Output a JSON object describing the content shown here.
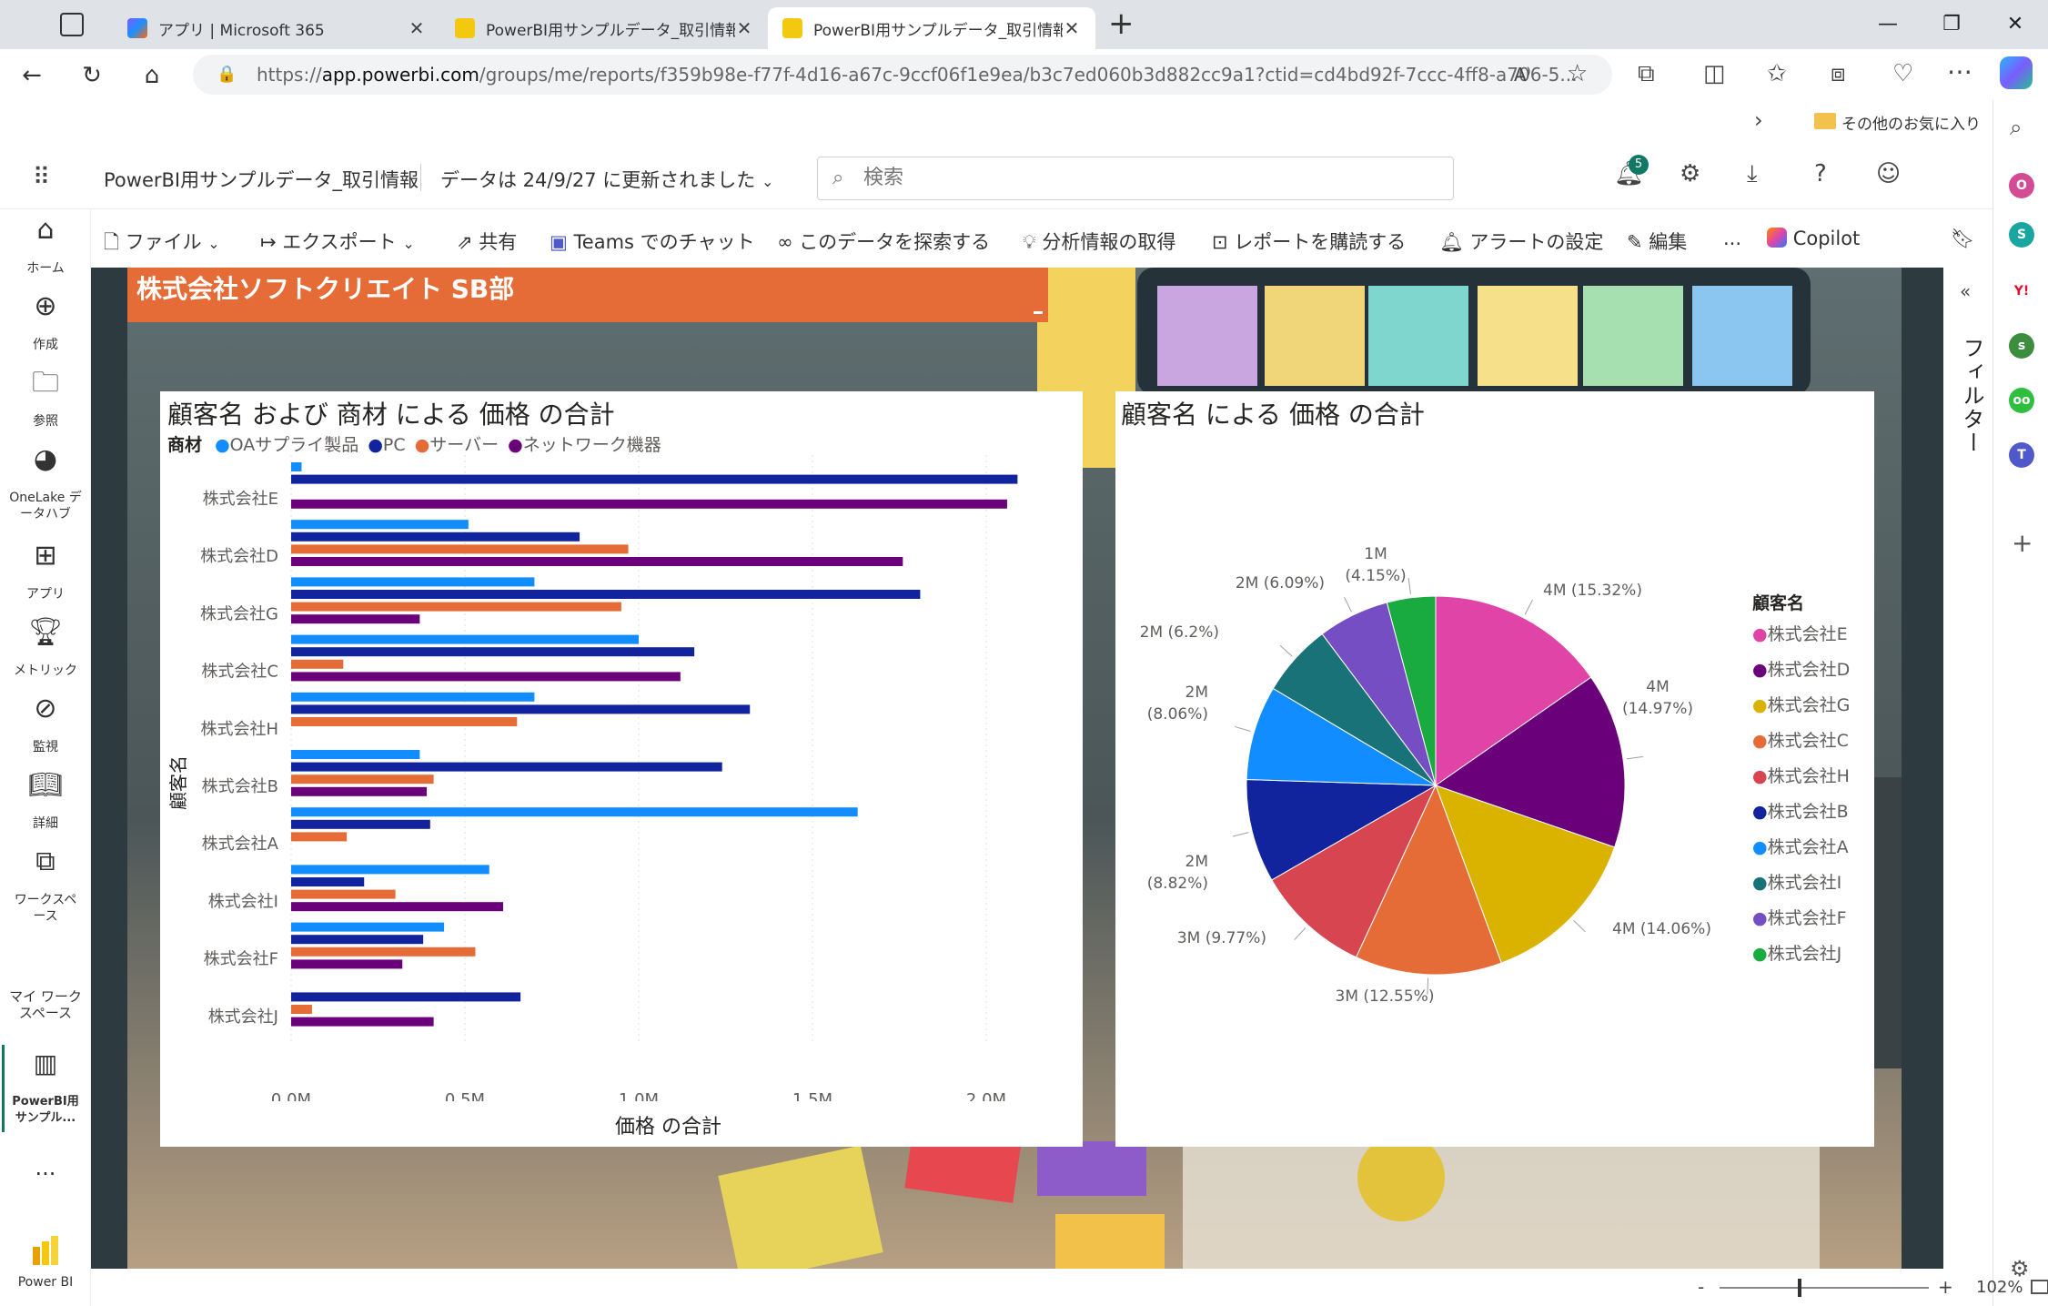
{
  "browser": {
    "tabs": [
      {
        "title": "アプリ | Microsoft 365",
        "active": false
      },
      {
        "title": "PowerBI用サンプルデータ_取引情報",
        "active": false
      },
      {
        "title": "PowerBI用サンプルデータ_取引情報",
        "active": true
      }
    ],
    "new_tab": "+",
    "url_prefix": "https://",
    "url_host": "app.powerbi.com",
    "url_rest": "/groups/me/reports/f359b98e-f77f-4d16-a67c-9ccf06f1e9ea/b3c7ed060b3d882cc9a1?ctid=cd4bd92f-7ccc-4ff8-a706-5...",
    "favorites_folder": "その他のお気に入り"
  },
  "pbi_header": {
    "report_title": "PowerBI用サンプルデータ_取引情報",
    "updated": "データは 24/9/27 に更新されました",
    "search_placeholder": "検索",
    "notification_count": "5"
  },
  "left_nav": [
    {
      "label": "ホーム",
      "icon": "home-icon"
    },
    {
      "label": "作成",
      "icon": "create-icon"
    },
    {
      "label": "参照",
      "icon": "browse-icon"
    },
    {
      "label": "OneLake デ\nータハブ",
      "icon": "onelake-icon"
    },
    {
      "label": "アプリ",
      "icon": "apps-icon"
    },
    {
      "label": "メトリック",
      "icon": "metrics-icon"
    },
    {
      "label": "監視",
      "icon": "monitor-icon"
    },
    {
      "label": "詳細",
      "icon": "learn-icon"
    },
    {
      "label": "ワークスペ\nース",
      "icon": "workspaces-icon"
    },
    {
      "label": "マイ ワーク\nスペース",
      "icon": ""
    },
    {
      "label": "PowerBI用\nサンプル...",
      "icon": "report-icon"
    },
    {
      "label": "...",
      "icon": ""
    },
    {
      "label": "Power BI",
      "icon": "powerbi-logo-icon"
    }
  ],
  "toolbar": {
    "file": "ファイル",
    "export": "エクスポート",
    "share": "共有",
    "teams": "Teams でのチャット",
    "explore": "このデータを探索する",
    "insights": "分析情報の取得",
    "subscribe": "レポートを購読する",
    "alert": "アラートの設定",
    "edit": "編集",
    "more": "...",
    "copilot": "Copilot"
  },
  "filter_pane_label": "フィルター",
  "report": {
    "banner_title": "株式会社ソフトクリエイト SB部"
  },
  "status": {
    "zoom": "102%",
    "minus": "-",
    "plus": "+"
  },
  "colors": {
    "banner": "#e66c37",
    "OA": "#118dff",
    "PC": "#12239e",
    "server": "#e66c37",
    "network": "#6b007b"
  },
  "chart_data": [
    {
      "type": "bar",
      "orientation": "horizontal",
      "title": "顧客名 および 商材 による 価格 の合計",
      "legend_title": "商材",
      "xlabel": "価格 の合計",
      "ylabel": "顧客名",
      "xlim": [
        0,
        2150000
      ],
      "x_ticks": [
        "0.0M",
        "0.5M",
        "1.0M",
        "1.5M",
        "2.0M"
      ],
      "categories": [
        "株式会社E",
        "株式会社D",
        "株式会社G",
        "株式会社C",
        "株式会社H",
        "株式会社B",
        "株式会社A",
        "株式会社I",
        "株式会社F",
        "株式会社J"
      ],
      "series": [
        {
          "name": "OAサプライ製品",
          "color": "#118dff",
          "values": [
            30000,
            510000,
            700000,
            1000000,
            700000,
            370000,
            1630000,
            570000,
            440000,
            null
          ]
        },
        {
          "name": "PC",
          "color": "#12239e",
          "values": [
            2090000,
            830000,
            1810000,
            1160000,
            1320000,
            1240000,
            400000,
            210000,
            380000,
            660000
          ]
        },
        {
          "name": "サーバー",
          "color": "#e66c37",
          "values": [
            null,
            970000,
            950000,
            150000,
            650000,
            410000,
            160000,
            300000,
            530000,
            60000
          ]
        },
        {
          "name": "ネットワーク機器",
          "color": "#6b007b",
          "values": [
            2060000,
            1760000,
            370000,
            1120000,
            null,
            390000,
            null,
            610000,
            320000,
            410000
          ]
        }
      ]
    },
    {
      "type": "pie",
      "title": "顧客名 による 価格 の合計",
      "legend_title": "顧客名",
      "slices": [
        {
          "name": "株式会社E",
          "value": 4.0,
          "percent": 15.32,
          "label": "4M (15.32%)",
          "color": "#e044a7"
        },
        {
          "name": "株式会社D",
          "value": 4.0,
          "percent": 14.97,
          "label": "4M\n(14.97%)",
          "color": "#6b007b"
        },
        {
          "name": "株式会社G",
          "value": 4.0,
          "percent": 14.06,
          "label": "4M (14.06%)",
          "color": "#d9b300"
        },
        {
          "name": "株式会社C",
          "value": 3.0,
          "percent": 12.55,
          "label": "3M (12.55%)",
          "color": "#e66c37"
        },
        {
          "name": "株式会社H",
          "value": 3.0,
          "percent": 9.77,
          "label": "3M (9.77%)",
          "color": "#d64550"
        },
        {
          "name": "株式会社B",
          "value": 2.0,
          "percent": 8.82,
          "label": "2M\n(8.82%)",
          "color": "#12239e"
        },
        {
          "name": "株式会社A",
          "value": 2.0,
          "percent": 8.06,
          "label": "2M\n(8.06%)",
          "color": "#118dff"
        },
        {
          "name": "株式会社I",
          "value": 2.0,
          "percent": 6.2,
          "label": "2M (6.2%)",
          "color": "#197278"
        },
        {
          "name": "株式会社F",
          "value": 2.0,
          "percent": 6.09,
          "label": "2M (6.09%)",
          "color": "#744ec2"
        },
        {
          "name": "株式会社J",
          "value": 1.0,
          "percent": 4.15,
          "label": "1M\n(4.15%)",
          "color": "#1aab40"
        }
      ]
    }
  ]
}
